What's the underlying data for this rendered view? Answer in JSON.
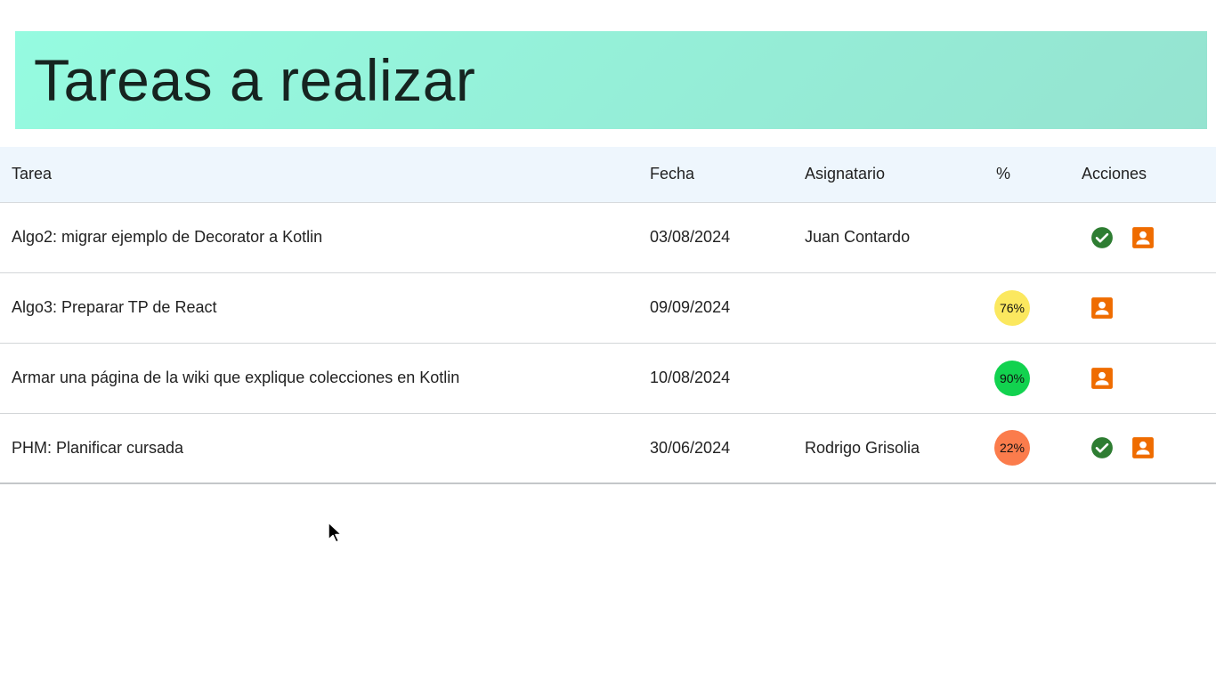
{
  "header": {
    "title": "Tareas a realizar"
  },
  "table": {
    "columns": {
      "tarea": "Tarea",
      "fecha": "Fecha",
      "asignatario": "Asignatario",
      "porcentaje": "%",
      "acciones": "Acciones"
    },
    "rows": [
      {
        "tarea": "Algo2: migrar ejemplo de Decorator a Kotlin",
        "fecha": "03/08/2024",
        "asignatario": "Juan Contardo",
        "porcentaje": "",
        "porcentaje_color": "",
        "actions": [
          "complete-icon",
          "assign-user-icon"
        ]
      },
      {
        "tarea": "Algo3: Preparar TP de React",
        "fecha": "09/09/2024",
        "asignatario": "",
        "porcentaje": "76%",
        "porcentaje_color": "#fbe85f",
        "actions": [
          "assign-user-icon"
        ]
      },
      {
        "tarea": "Armar una página de la wiki que explique colecciones en Kotlin",
        "fecha": "10/08/2024",
        "asignatario": "",
        "porcentaje": "90%",
        "porcentaje_color": "#12d24f",
        "actions": [
          "assign-user-icon"
        ]
      },
      {
        "tarea": "PHM: Planificar cursada",
        "fecha": "30/06/2024",
        "asignatario": "Rodrigo Grisolia",
        "porcentaje": "22%",
        "porcentaje_color": "#fb7c4c",
        "actions": [
          "complete-icon",
          "assign-user-icon"
        ]
      }
    ]
  },
  "colors": {
    "banner_gradient_start": "#95fbe0",
    "banner_gradient_end": "#95e3d0",
    "header_row_bg": "#eef6fd",
    "complete_icon": "#2e7d32",
    "assign_icon": "#ef6c00"
  }
}
